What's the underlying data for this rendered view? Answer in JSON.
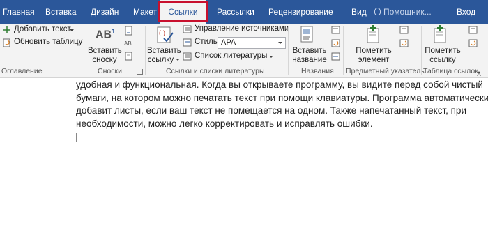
{
  "tabs": [
    {
      "label": "Главная"
    },
    {
      "label": "Вставка"
    },
    {
      "label": "Дизайн"
    },
    {
      "label": "Макет"
    },
    {
      "label": "Ссылки"
    },
    {
      "label": "Рассылки"
    },
    {
      "label": "Рецензирование"
    },
    {
      "label": "Вид"
    }
  ],
  "active_tab": "Ссылки",
  "tell_me": "Помощник...",
  "sign_in": "Вход",
  "ribbon": {
    "toc": {
      "add_text": "Добавить текст",
      "update_table": "Обновить таблицу",
      "group_label": "Оглавление"
    },
    "footnotes": {
      "insert_footnote_line1": "Вставить",
      "insert_footnote_line2": "сноску",
      "ab_icon_text": "AB",
      "ab_superscript": "1",
      "group_label": "Сноски"
    },
    "citations": {
      "insert_citation_line1": "Вставить",
      "insert_citation_line2": "ссылку",
      "manage_sources": "Управление источниками",
      "style_label": "Стиль:",
      "style_value": "APA",
      "bibliography": "Список литературы",
      "group_label": "Ссылки и списки литературы"
    },
    "captions": {
      "insert_caption_line1": "Вставить",
      "insert_caption_line2": "название",
      "group_label": "Названия"
    },
    "index": {
      "mark_entry_line1": "Пометить",
      "mark_entry_line2": "элемент",
      "group_label": "Предметный указатель"
    },
    "authorities": {
      "mark_citation_line1": "Пометить",
      "mark_citation_line2": "ссылку",
      "group_label": "Таблица ссылок"
    }
  },
  "colors": {
    "tab_bar": "#2b579a",
    "ribbon": "#f3f3f3",
    "highlight": "#c8102e"
  },
  "document": {
    "lines": [
      "удобная и функциональная. Когда вы открываете программу, вы видите перед собой чистый",
      "бумаги, на котором можно печатать текст при помощи клавиатуры. Программа автоматически",
      "добавит листы, если ваш текст не помещается на одном. Также напечатанный текст, при",
      "необходимости, можно легко корректировать и исправлять ошибки."
    ]
  }
}
